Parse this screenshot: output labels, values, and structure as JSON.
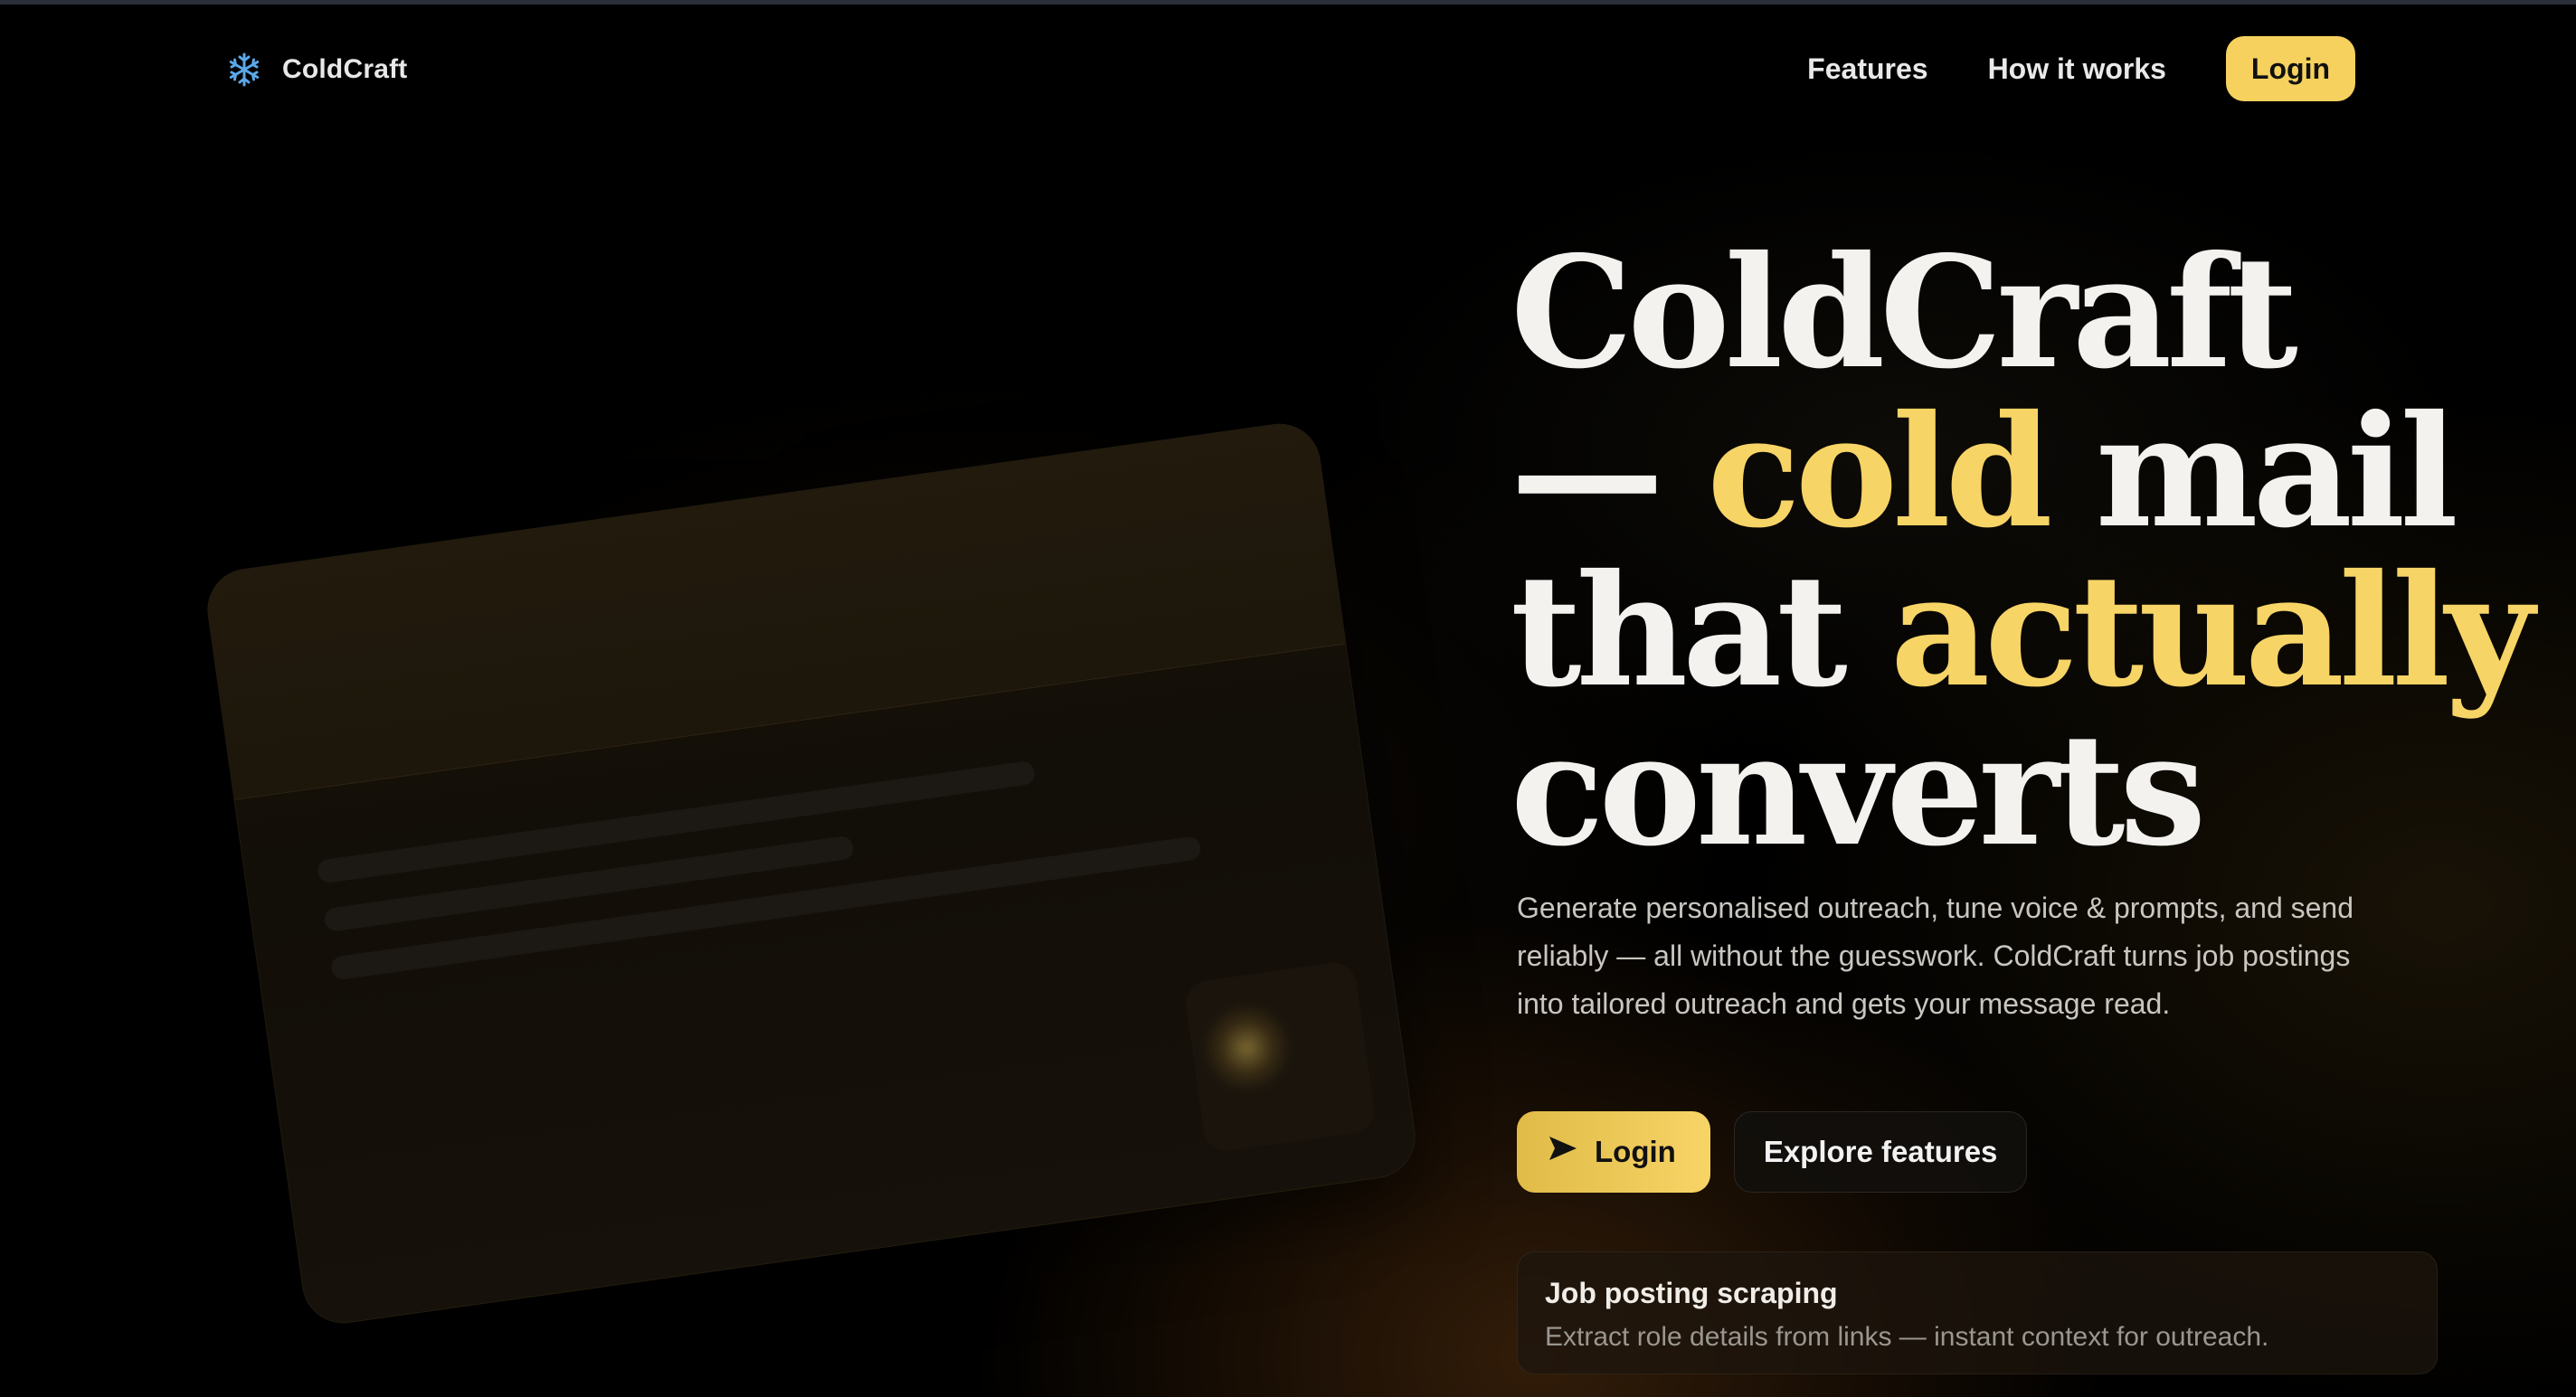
{
  "nav": {
    "brand": "ColdCraft",
    "brand_icon": "snowflake-icon",
    "links": [
      "Features",
      "How it works"
    ],
    "login_label": "Login"
  },
  "hero": {
    "title": {
      "line1": "ColdCraft",
      "line2_prefix": "— ",
      "line2_accent": "cold",
      "line2_suffix": " mail",
      "line3_prefix": "that ",
      "line3_accent": "actually",
      "line4": "converts"
    },
    "description": "Generate personalised outreach, tune voice & prompts, and send reliably — all without the guesswork. ColdCraft turns job postings into tailored outreach and gets your message read.",
    "cta_login_label": "Login",
    "cta_login_icon": "send-arrow-icon",
    "cta_explore_label": "Explore features"
  },
  "feature": {
    "title": "Job posting scraping",
    "description": "Extract role details from links — instant context for outreach."
  },
  "colors": {
    "accent": "#f7d466",
    "background": "#000000",
    "text": "#f3f2ee"
  }
}
